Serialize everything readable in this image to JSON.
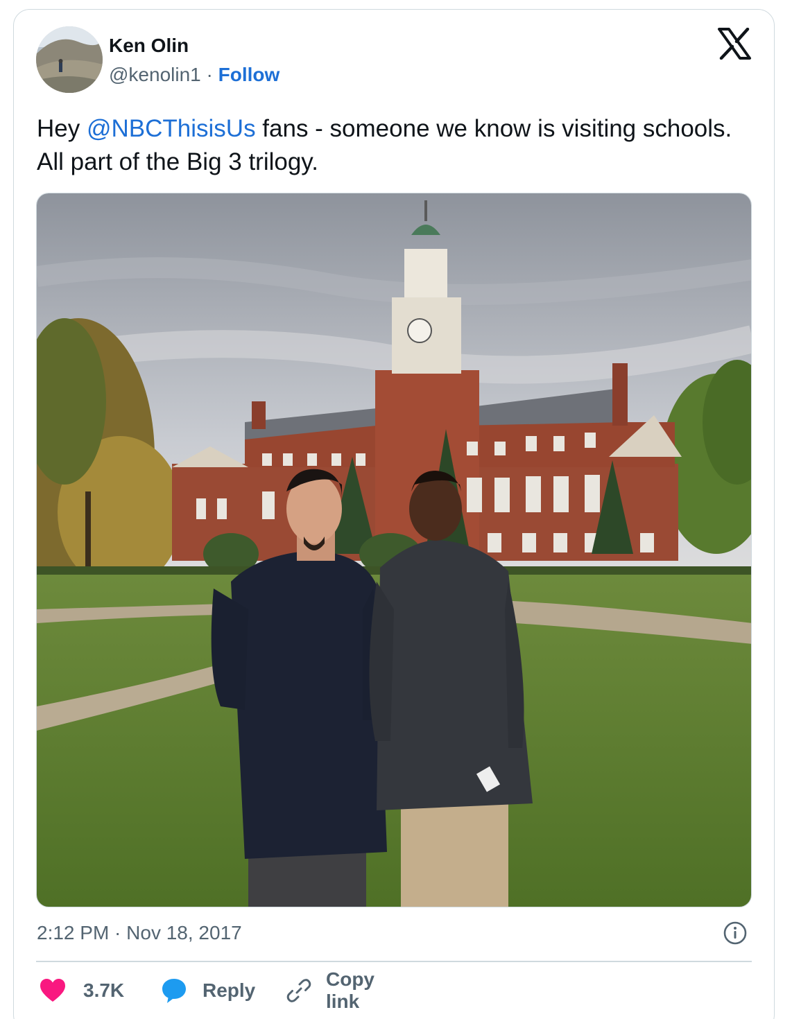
{
  "author": {
    "name": "Ken Olin",
    "handle": "@kenolin1",
    "separator": "·",
    "follow_label": "Follow"
  },
  "tweet": {
    "text_before": "Hey ",
    "mention": "@NBCThisisUs",
    "text_after": " fans - someone we know is visiting schools. All part of the Big 3 trilogy."
  },
  "timestamp": "2:12 PM · Nov 18, 2017",
  "actions": {
    "like_count": "3.7K",
    "reply_label": "Reply",
    "copy_link_label": "Copy link"
  },
  "icons": {
    "logo": "x-logo-icon",
    "info": "info-icon",
    "like": "heart-icon",
    "reply": "reply-bubble-icon",
    "copy": "link-icon"
  },
  "colors": {
    "link": "#1d6fd6",
    "secondary_text": "#536471",
    "heart": "#f91880",
    "reply_bubble": "#1d9bf0",
    "border": "#cfd9de"
  }
}
